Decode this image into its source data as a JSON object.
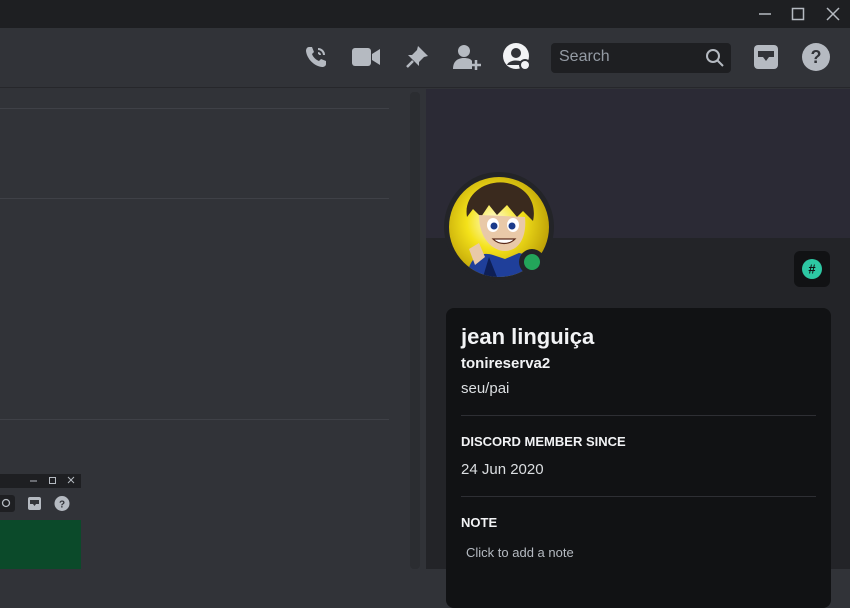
{
  "window": {
    "minimize_icon": "minimize-icon",
    "maximize_icon": "maximize-icon",
    "close_icon": "close-icon"
  },
  "toolbar": {
    "icons": [
      "call-icon",
      "video-icon",
      "pin-icon",
      "add-friend-icon",
      "user-profile-icon",
      "inbox-icon",
      "help-icon"
    ],
    "search_placeholder": "Search"
  },
  "profile": {
    "display_name": "jean linguiça",
    "username": "tonireserva2",
    "pronouns": "seu/pai",
    "member_since_label": "DISCORD MEMBER SINCE",
    "member_since": "24 Jun 2020",
    "note_label": "NOTE",
    "note_placeholder": "Click to add a note",
    "status": "online",
    "status_color": "#23a55a",
    "badge_icon": "hashtag-icon",
    "badge_color": "#2dc7a3"
  }
}
